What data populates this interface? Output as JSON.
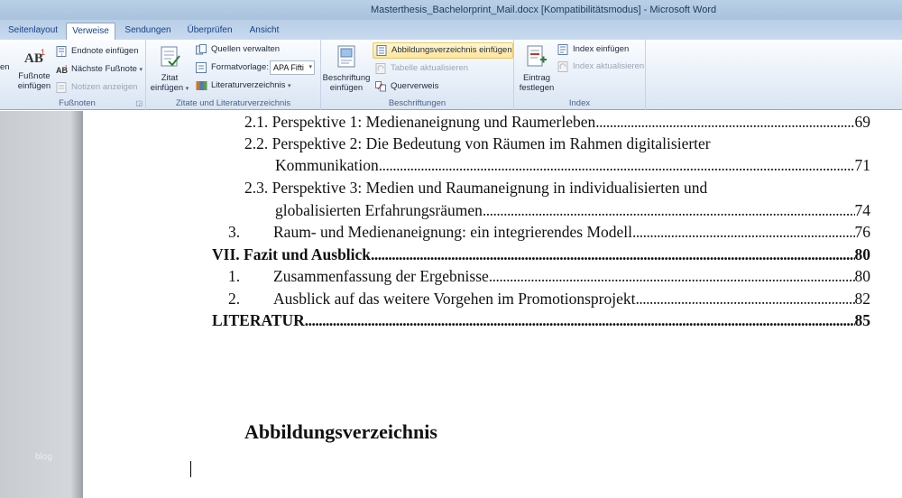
{
  "window": {
    "title": "Masterthesis_Bachelorprint_Mail.docx [Kompatibilitätsmodus]  -  Microsoft Word"
  },
  "tabs": [
    {
      "label": "Seitenlayout"
    },
    {
      "label": "Verweise"
    },
    {
      "label": "Sendungen"
    },
    {
      "label": "Überprüfen"
    },
    {
      "label": "Ansicht"
    }
  ],
  "ribbon": {
    "edge_fragment": "en",
    "footnotes": {
      "group_label": "Fußnoten",
      "insert_footnote": "Fußnote einfügen",
      "insert_footnote_line1": "Fußnote",
      "insert_footnote_line2": "einfügen",
      "insert_endnote": "Endnote einfügen",
      "next_footnote": "Nächste Fußnote",
      "show_notes": "Notizen anzeigen"
    },
    "citations": {
      "group_label": "Zitate und Literaturverzeichnis",
      "insert_citation_line1": "Zitat",
      "insert_citation_line2": "einfügen",
      "manage_sources": "Quellen verwalten",
      "style_label": "Formatvorlage:",
      "style_value": "APA Fifti",
      "bibliography": "Literaturverzeichnis"
    },
    "captions": {
      "group_label": "Beschriftungen",
      "insert_caption_line1": "Beschriftung",
      "insert_caption_line2": "einfügen",
      "insert_table_of_figures": "Abbildungsverzeichnis einfügen",
      "update_table": "Tabelle aktualisieren",
      "cross_reference": "Querverweis"
    },
    "index": {
      "group_label": "Index",
      "mark_entry_line1": "Eintrag",
      "mark_entry_line2": "festlegen",
      "insert_index": "Index einfügen",
      "update_index": "Index aktualisieren"
    }
  },
  "document": {
    "toc": [
      {
        "num": "2.1.",
        "text": "Perspektive 1: Medienaneignung und Raumerleben",
        "page": "69"
      },
      {
        "num": "2.2.",
        "text": "Perspektive 2: Die Bedeutung von Räumen im Rahmen digitalisierter",
        "cont": "Kommunikation",
        "page": "71"
      },
      {
        "num": "2.3.",
        "text": "Perspektive 3: Medien und Raumaneignung in individualisierten und",
        "cont": "globalisierten Erfahrungsräumen",
        "page": "74"
      },
      {
        "num": "3.",
        "text": "Raum- und Medienaneignung: ein integrierendes Modell",
        "page": "76"
      },
      {
        "text": "VII. Fazit und Ausblick",
        "page": "80"
      },
      {
        "num": "1.",
        "text": "Zusammenfassung der Ergebnisse",
        "page": "80"
      },
      {
        "num": "2.",
        "text": "Ausblick auf das weitere Vorgehen im Promotionsprojekt",
        "page": "82"
      },
      {
        "text": "LITERATUR",
        "page": "85"
      }
    ],
    "heading": "Abbildungsverzeichnis",
    "watermark": "blog"
  }
}
